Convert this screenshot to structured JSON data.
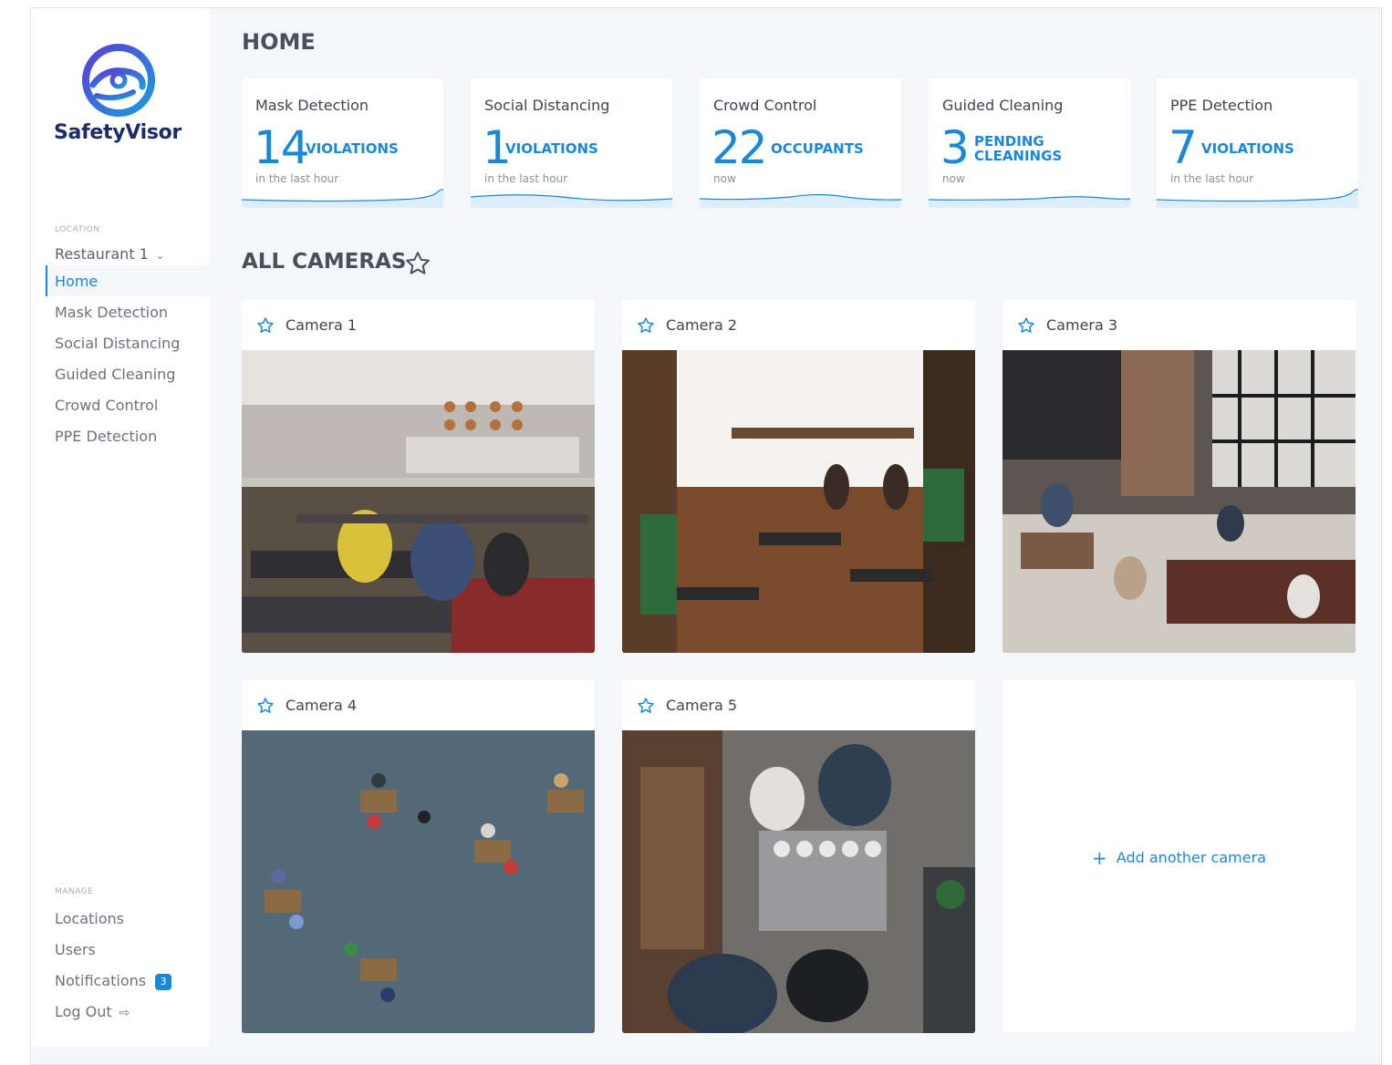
{
  "app": {
    "brand": "SafetyVisor"
  },
  "colors": {
    "accent": "#1a88d8",
    "brand_dark": "#1f2a6b",
    "background": "#f4f6f9"
  },
  "sidebar": {
    "location_label": "LOCATION",
    "location_value": "Restaurant 1",
    "nav": [
      {
        "label": "Home",
        "active": true
      },
      {
        "label": "Mask Detection"
      },
      {
        "label": "Social Distancing"
      },
      {
        "label": "Guided Cleaning"
      },
      {
        "label": "Crowd Control"
      },
      {
        "label": "PPE Detection"
      }
    ],
    "manage_label": "MANAGE",
    "manage": [
      {
        "label": "Locations"
      },
      {
        "label": "Users"
      },
      {
        "label": "Notifications",
        "badge": "3"
      },
      {
        "label": "Log Out",
        "icon": "logout-icon"
      }
    ]
  },
  "page": {
    "title": "HOME"
  },
  "stats": [
    {
      "title": "Mask Detection",
      "value": "14",
      "unit": "VIOLATIONS",
      "sub": "in the last hour"
    },
    {
      "title": "Social Distancing",
      "value": "1",
      "unit": "VIOLATIONS",
      "sub": "in the last hour"
    },
    {
      "title": "Crowd Control",
      "value": "22",
      "unit": "OCCUPANTS",
      "sub": "now"
    },
    {
      "title": "Guided Cleaning",
      "value": "3",
      "unit": "PENDING CLEANINGS",
      "sub": "now"
    },
    {
      "title": "PPE Detection",
      "value": "7",
      "unit": "VIOLATIONS",
      "sub": "in the last hour"
    }
  ],
  "cameras_section": {
    "title": "ALL CAMERAS",
    "icon": "star-outline-icon"
  },
  "cameras": [
    {
      "name": "Camera 1",
      "scene": "restaurant-dining-room"
    },
    {
      "name": "Camera 2",
      "scene": "cafe-interior"
    },
    {
      "name": "Camera 3",
      "scene": "cafe-top-view"
    },
    {
      "name": "Camera 4",
      "scene": "courtyard-tables-top-view"
    },
    {
      "name": "Camera 5",
      "scene": "coffee-bar-top-view"
    }
  ],
  "add_camera": {
    "label": "Add another camera"
  }
}
